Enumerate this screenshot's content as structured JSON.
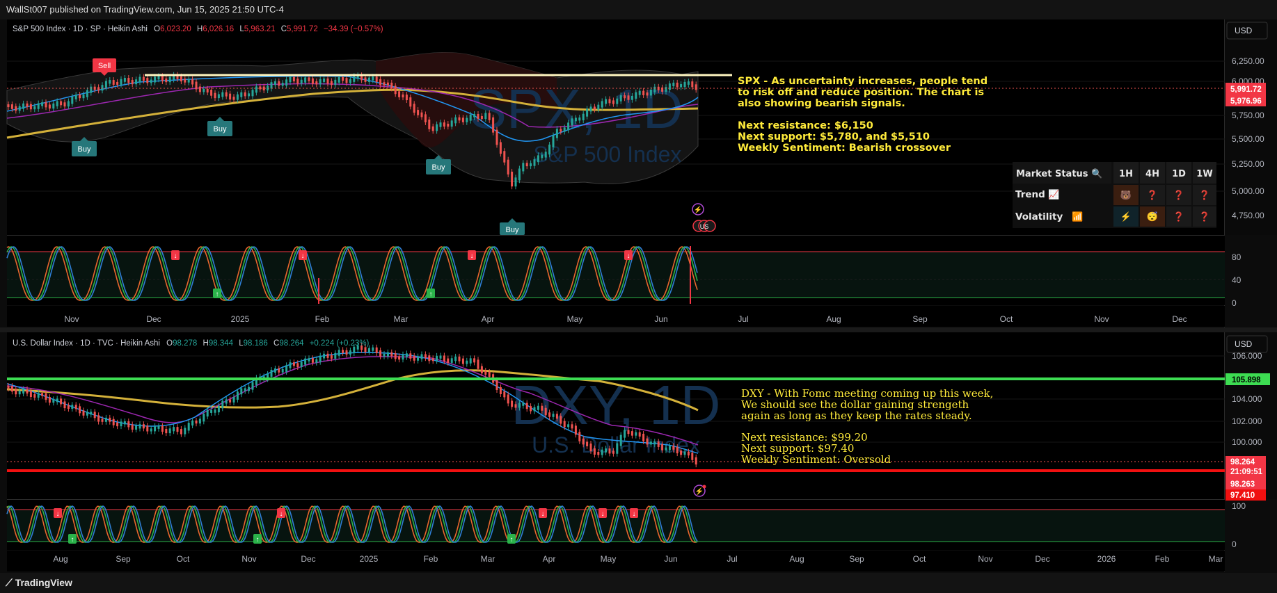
{
  "header": {
    "publish_line": "WallSt007 published on TradingView.com, Jun 15, 2025 21:50 UTC-4"
  },
  "footer": {
    "brand": "TradingView"
  },
  "colors": {
    "bull": "#26a69a",
    "bear": "#ef5350",
    "ma50": "#2196f3",
    "ma100": "#9c27b0",
    "ma200": "#d4b13a",
    "note": "#ffeb3b"
  },
  "spx": {
    "title": "S&P 500 Index · 1D · SP · Heikin Ashi",
    "o_label": "O",
    "o": "6,023.20",
    "h_label": "H",
    "h": "6,026.16",
    "l_label": "L",
    "l": "5,963.21",
    "c_label": "C",
    "c": "5,991.72",
    "chg": "−34.39 (−0.57%)",
    "watermark_symbol": "SPX, 1D",
    "watermark_name": "S&P 500 Index",
    "currency": "USD",
    "price_ticks": [
      "6,250.00",
      "6,000.00",
      "5,750.00",
      "5,500.00",
      "5,250.00",
      "5,000.00",
      "4,750.00"
    ],
    "price_label_1": "5,991.72",
    "price_label_2": "5,976.96",
    "osc_ticks": [
      "80",
      "40",
      "0"
    ],
    "months": [
      "Nov",
      "Dec",
      "2025",
      "Feb",
      "Mar",
      "Apr",
      "May",
      "Jun",
      "Jul",
      "Aug",
      "Sep",
      "Oct",
      "Nov",
      "Dec"
    ],
    "signals": [
      "Sell",
      "Buy",
      "Buy",
      "Buy",
      "Buy"
    ],
    "note": {
      "line1": "SPX - As uncertainty increases, people tend",
      "line2": "to risk off and reduce position. The chart is",
      "line3": "also showing bearish signals.",
      "line4": "Next resistance: $6,150",
      "line5": "Next support: $5,780, and $5,510",
      "line6": "Weekly Sentiment: Bearish crossover"
    },
    "status_table": {
      "title": "Market Status",
      "title_icon": "🔍",
      "headers": [
        "1H",
        "4H",
        "1D",
        "1W"
      ],
      "rows": [
        {
          "label": "Trend",
          "icon": "📈",
          "cells": [
            "🐻",
            "❓",
            "❓",
            "❓"
          ]
        },
        {
          "label": "Volatility",
          "icon": "📶",
          "cells": [
            "⚡",
            "😴",
            "❓",
            "❓"
          ]
        }
      ]
    }
  },
  "dxy": {
    "title": "U.S. Dollar Index · 1D · TVC · Heikin Ashi",
    "o_label": "O",
    "o": "98.278",
    "h_label": "H",
    "h": "98.344",
    "l_label": "L",
    "l": "98.186",
    "c_label": "C",
    "c": "98.264",
    "chg": "+0.224 (+0.23%)",
    "watermark_symbol": "DXY, 1D",
    "watermark_name": "U.S. Dollar Index",
    "currency": "USD",
    "price_ticks": [
      "106.000",
      "104.000",
      "102.000",
      "100.000"
    ],
    "level_label": "105.898",
    "price_label_1": "98.264",
    "countdown": "21:09:51",
    "price_label_2": "98.263",
    "price_label_3": "97.410",
    "osc_ticks": [
      "100",
      "0"
    ],
    "months": [
      "Aug",
      "Sep",
      "Oct",
      "Nov",
      "Dec",
      "2025",
      "Feb",
      "Mar",
      "Apr",
      "May",
      "Jun",
      "Jul",
      "Aug",
      "Sep",
      "Oct",
      "Nov",
      "Dec",
      "2026",
      "Feb",
      "Mar"
    ],
    "note": {
      "line1": "DXY - With Fomc meeting coming up this week,",
      "line2": "We should see the dollar gaining strengeth",
      "line3": "again as long as they keep the rates steady.",
      "line4": "Next resistance: $99.20",
      "line5": "Next support: $97.40",
      "line6": "Weekly Sentiment: Oversold"
    }
  }
}
